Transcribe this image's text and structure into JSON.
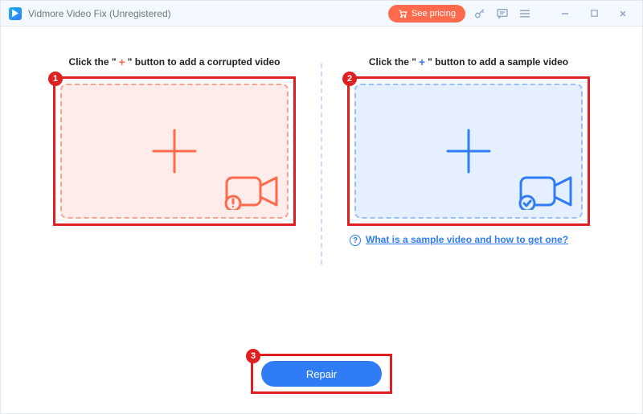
{
  "titlebar": {
    "app_title": "Vidmore Video Fix (Unregistered)",
    "see_pricing_label": "See pricing"
  },
  "annotations": {
    "step1": "1",
    "step2": "2",
    "step3": "3"
  },
  "left_panel": {
    "instruction_prefix": "Click the \"",
    "instruction_plus": "+",
    "instruction_suffix": "\" button to add a corrupted video"
  },
  "right_panel": {
    "instruction_prefix": "Click the \"",
    "instruction_plus": "+",
    "instruction_suffix": "\" button to add a sample video",
    "help_link": "What is a sample video and how to get one?"
  },
  "repair": {
    "label": "Repair"
  }
}
